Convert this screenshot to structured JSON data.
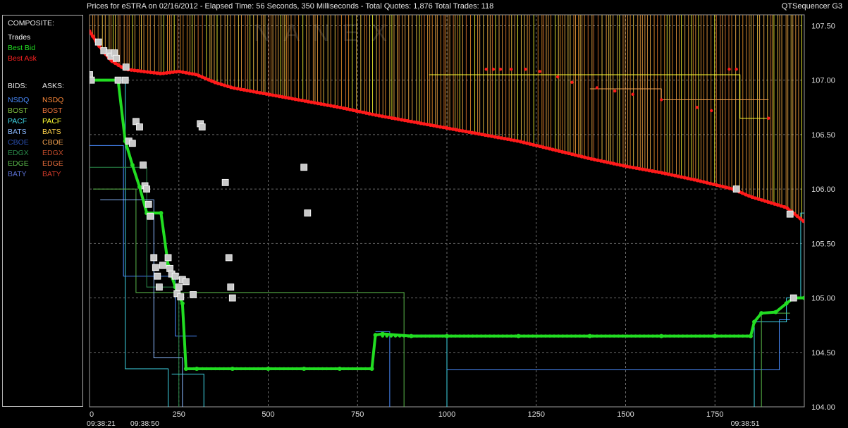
{
  "header": {
    "title": "Prices for  eSTRA  on  02/16/2012  - Elapsed Time: 56 Seconds, 350 Milliseconds  - Total Quotes: 1,876  Total Trades: 118",
    "app_name": "QTSequencer G3"
  },
  "watermark": "NANEX",
  "legend": {
    "composite_label": "COMPOSITE:",
    "composite": [
      {
        "label": "Trades",
        "color": "#ffffff"
      },
      {
        "label": "Best Bid",
        "color": "#22dd22"
      },
      {
        "label": "Best Ask",
        "color": "#ff2222"
      }
    ],
    "bids_label": "BIDS:",
    "asks_label": "ASKS:",
    "exchanges": [
      {
        "bid": "NSDQ",
        "bid_color": "#4a8cff",
        "ask": "NSDQ",
        "ask_color": "#ff8a3a"
      },
      {
        "bid": "BOST",
        "bid_color": "#7fbf3f",
        "ask": "BOST",
        "ask_color": "#e8703a"
      },
      {
        "bid": "PACF",
        "bid_color": "#3fd8e8",
        "ask": "PACF",
        "ask_color": "#ffff33"
      },
      {
        "bid": "BATS",
        "bid_color": "#8ab8ff",
        "ask": "BATS",
        "ask_color": "#ffd24a"
      },
      {
        "bid": "CBOE",
        "bid_color": "#2a4fb0",
        "ask": "CBOE",
        "ask_color": "#f0a050"
      },
      {
        "bid": "EDGX",
        "bid_color": "#2a8a4a",
        "ask": "EDGX",
        "ask_color": "#c04a2a"
      },
      {
        "bid": "EDGE",
        "bid_color": "#5ab84a",
        "ask": "EDGE",
        "ask_color": "#e06a3a"
      },
      {
        "bid": "BATY",
        "bid_color": "#5a6fd0",
        "ask": "BATY",
        "ask_color": "#d03a2a"
      }
    ]
  },
  "chart_data": {
    "type": "line",
    "title": "Prices for  eSTRA  on  02/16/2012",
    "xlabel": "",
    "ylabel": "",
    "xlim": [
      0,
      2000
    ],
    "ylim": [
      104.0,
      107.6
    ],
    "x_ticks": [
      0,
      250,
      500,
      750,
      1000,
      1250,
      1500,
      1750
    ],
    "y_ticks": [
      "104.00",
      "104.50",
      "105.00",
      "105.50",
      "106.00",
      "106.50",
      "107.00",
      "107.50"
    ],
    "time_labels": [
      {
        "x": 0,
        "label": "09:38:21"
      },
      {
        "x": 130,
        "label": "09:38:50"
      },
      {
        "x": 1810,
        "label": "09:38:51"
      }
    ],
    "grid": true,
    "series": [
      {
        "name": "Best Ask",
        "color": "#ff1a1a",
        "points": [
          [
            0,
            107.45
          ],
          [
            25,
            107.32
          ],
          [
            60,
            107.18
          ],
          [
            100,
            107.1
          ],
          [
            150,
            107.08
          ],
          [
            200,
            107.06
          ],
          [
            250,
            107.08
          ],
          [
            300,
            107.05
          ],
          [
            350,
            106.98
          ],
          [
            400,
            106.93
          ],
          [
            500,
            106.87
          ],
          [
            600,
            106.81
          ],
          [
            700,
            106.75
          ],
          [
            800,
            106.68
          ],
          [
            900,
            106.62
          ],
          [
            1000,
            106.56
          ],
          [
            1100,
            106.5
          ],
          [
            1200,
            106.44
          ],
          [
            1300,
            106.36
          ],
          [
            1400,
            106.28
          ],
          [
            1500,
            106.21
          ],
          [
            1600,
            106.15
          ],
          [
            1700,
            106.08
          ],
          [
            1800,
            106.0
          ],
          [
            1850,
            105.93
          ],
          [
            1900,
            105.88
          ],
          [
            1950,
            105.83
          ],
          [
            2000,
            105.7
          ]
        ]
      },
      {
        "name": "Best Bid",
        "color": "#22dd22",
        "points": [
          [
            0,
            107.0
          ],
          [
            80,
            107.0
          ],
          [
            100,
            106.44
          ],
          [
            120,
            106.22
          ],
          [
            140,
            106.02
          ],
          [
            160,
            105.78
          ],
          [
            200,
            105.78
          ],
          [
            220,
            105.3
          ],
          [
            240,
            105.1
          ],
          [
            260,
            104.95
          ],
          [
            270,
            104.35
          ],
          [
            300,
            104.35
          ],
          [
            400,
            104.35
          ],
          [
            500,
            104.35
          ],
          [
            600,
            104.35
          ],
          [
            700,
            104.35
          ],
          [
            790,
            104.35
          ],
          [
            800,
            104.66
          ],
          [
            820,
            104.67
          ],
          [
            900,
            104.65
          ],
          [
            1000,
            104.65
          ],
          [
            1200,
            104.65
          ],
          [
            1400,
            104.65
          ],
          [
            1600,
            104.65
          ],
          [
            1750,
            104.65
          ],
          [
            1850,
            104.65
          ],
          [
            1860,
            104.78
          ],
          [
            1880,
            104.86
          ],
          [
            1920,
            104.87
          ],
          [
            1950,
            104.95
          ],
          [
            1970,
            105.0
          ],
          [
            2000,
            105.0
          ]
        ]
      },
      {
        "name": "Trades",
        "color": "#cccccc",
        "points": [
          [
            0,
            107.05
          ],
          [
            5,
            107.0
          ],
          [
            25,
            107.35
          ],
          [
            40,
            107.27
          ],
          [
            55,
            107.25
          ],
          [
            60,
            107.22
          ],
          [
            70,
            107.25
          ],
          [
            75,
            107.2
          ],
          [
            80,
            107.0
          ],
          [
            100,
            107.0
          ],
          [
            102,
            107.12
          ],
          [
            110,
            106.44
          ],
          [
            120,
            106.42
          ],
          [
            130,
            106.62
          ],
          [
            140,
            106.57
          ],
          [
            150,
            106.22
          ],
          [
            155,
            106.03
          ],
          [
            160,
            106.0
          ],
          [
            165,
            105.86
          ],
          [
            170,
            105.75
          ],
          [
            180,
            105.37
          ],
          [
            185,
            105.28
          ],
          [
            190,
            105.2
          ],
          [
            195,
            105.1
          ],
          [
            205,
            105.3
          ],
          [
            220,
            105.37
          ],
          [
            225,
            105.27
          ],
          [
            230,
            105.22
          ],
          [
            240,
            105.2
          ],
          [
            245,
            105.04
          ],
          [
            250,
            105.1
          ],
          [
            255,
            105.01
          ],
          [
            260,
            105.17
          ],
          [
            270,
            105.15
          ],
          [
            290,
            105.03
          ],
          [
            310,
            106.6
          ],
          [
            315,
            106.57
          ],
          [
            380,
            106.06
          ],
          [
            390,
            105.37
          ],
          [
            395,
            105.1
          ],
          [
            400,
            105.0
          ],
          [
            600,
            106.2
          ],
          [
            610,
            105.78
          ],
          [
            1810,
            106.0
          ],
          [
            1960,
            105.77
          ],
          [
            1970,
            105.0
          ]
        ]
      }
    ]
  }
}
